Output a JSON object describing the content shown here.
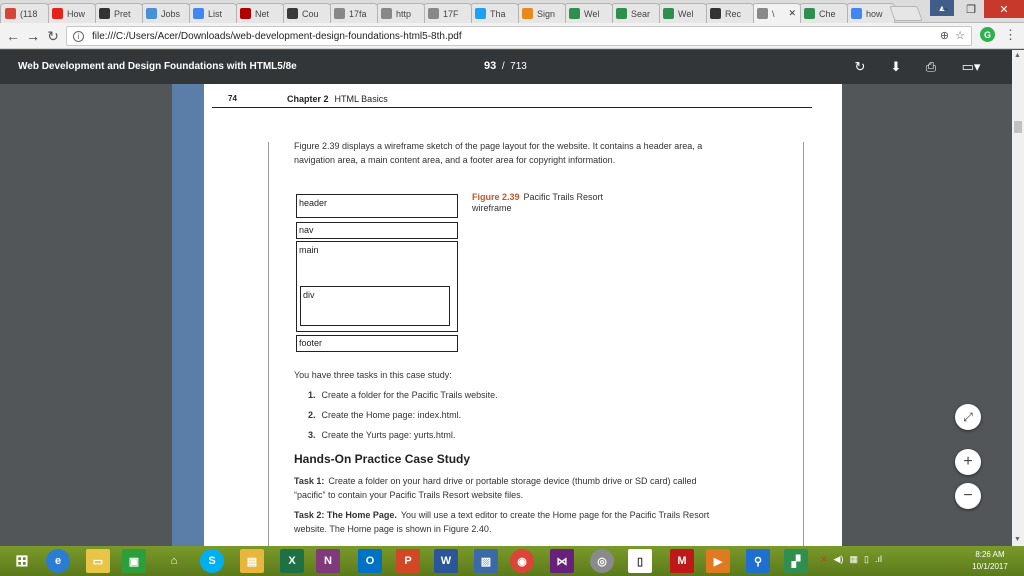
{
  "tabs": [
    {
      "label": "(118",
      "color": "#d44638",
      "icon": "mail-icon"
    },
    {
      "label": "How",
      "color": "#e62117",
      "icon": "youtube-icon"
    },
    {
      "label": "Pret",
      "color": "#333333",
      "icon": "w-icon"
    },
    {
      "label": "Jobs",
      "color": "#4a90d9",
      "icon": "person-icon"
    },
    {
      "label": "List",
      "color": "#4285f4",
      "icon": "google-icon"
    },
    {
      "label": "Net",
      "color": "#b00000",
      "icon": "n-icon"
    },
    {
      "label": "Cou",
      "color": "#3a3a3a",
      "icon": "badge-icon"
    },
    {
      "label": "17fa",
      "color": "#888888",
      "icon": "page-icon"
    },
    {
      "label": "http",
      "color": "#888888",
      "icon": "page-icon"
    },
    {
      "label": "17F",
      "color": "#888888",
      "icon": "page-icon"
    },
    {
      "label": "Tha",
      "color": "#1da1f2",
      "icon": "t-icon"
    },
    {
      "label": "Sign",
      "color": "#e88a1a",
      "icon": "puzzle-icon"
    },
    {
      "label": "Wel",
      "color": "#2f8f4e",
      "icon": "c-icon"
    },
    {
      "label": "Sear",
      "color": "#2f8f4e",
      "icon": "c-icon"
    },
    {
      "label": "Wel",
      "color": "#2f8f4e",
      "icon": "c-icon"
    },
    {
      "label": "Rec",
      "color": "#333333",
      "icon": "b-icon"
    },
    {
      "label": "\\",
      "color": "#888888",
      "icon": "page-icon",
      "active": true
    },
    {
      "label": "Che",
      "color": "#2f8f4e",
      "icon": "c-icon"
    },
    {
      "label": "how",
      "color": "#4285f4",
      "icon": "google-icon"
    }
  ],
  "window": {
    "minimize": "–",
    "restore": "❐",
    "close": "✕"
  },
  "address": {
    "url": "file:///C:/Users/Acer/Downloads/web-development-design-foundations-html5-8th.pdf"
  },
  "pdf": {
    "title": "Web Development and Design Foundations with HTML5/8e",
    "current_page": "93",
    "total_pages": "713",
    "separator": "/"
  },
  "page": {
    "chapter_number": "74",
    "chapter_label": "Chapter 2",
    "chapter_title": "HTML Basics",
    "intro": "Figure 2.39 displays a wireframe sketch of the page layout for the website. It contains a header area, a navigation area, a main content area, and a footer area for copyright information.",
    "wireframe": {
      "header": "header",
      "nav": "nav",
      "main": "main",
      "div": "div",
      "footer": "footer"
    },
    "figure_number": "Figure 2.39",
    "figure_caption": "Pacific Trails Resort wireframe",
    "tasks_intro": "You have three tasks in this case study:",
    "tasks": [
      {
        "num": "1.",
        "text": "Create a folder for the Pacific Trails website."
      },
      {
        "num": "2.",
        "text": "Create the Home page: index.html."
      },
      {
        "num": "3.",
        "text": "Create the Yurts page: yurts.html."
      }
    ],
    "section_heading": "Hands-On Practice Case Study",
    "task1_label": "Task 1:",
    "task1_text": "Create a folder on your hard drive or portable storage device (thumb drive or SD card) called “pacific” to contain your Pacific Trails Resort website files.",
    "task2_label": "Task 2: The Home Page.",
    "task2_text": "You will use a text editor to create the Home page for the Pacific Trails Resort website. The Home page is shown in Figure 2.40."
  },
  "zoom": {
    "fit": "⤢",
    "in": "+",
    "out": "−"
  },
  "clock": {
    "time": "8:26 AM",
    "date": "10/1/2017"
  },
  "colors": {
    "pdf_toolbar": "#323639",
    "accent": "#c0562e",
    "sidebar": "#5a7ea8"
  }
}
